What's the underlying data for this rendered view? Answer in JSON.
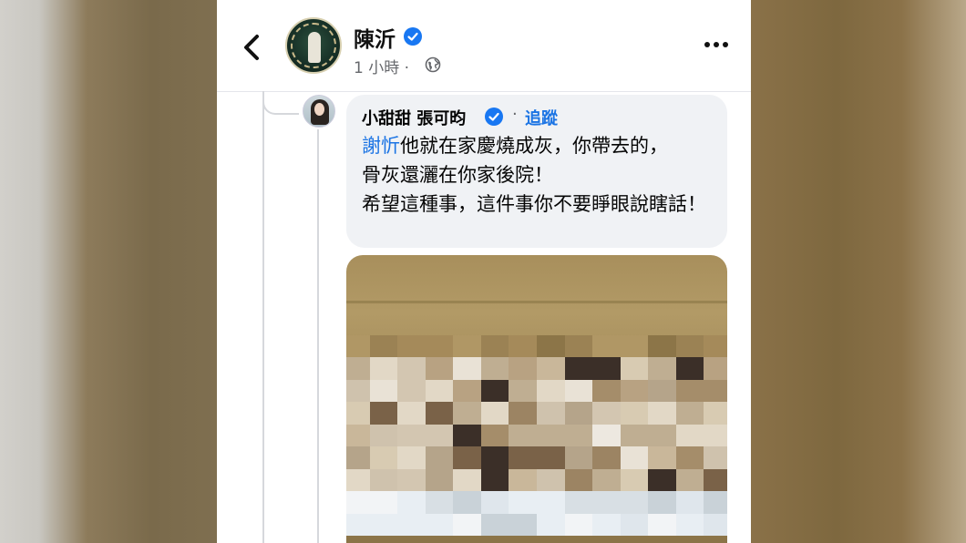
{
  "header": {
    "page_name": "陳沂",
    "timestamp": "1 小時",
    "separator": "·"
  },
  "comment": {
    "author": "小甜甜 張可昀",
    "separator": "·",
    "follow_label": "追蹤",
    "mention": "謝忻",
    "text_line1": "他就在家慶燒成灰，你帶去的，",
    "text_line2": "骨灰還灑在你家後院！",
    "text_line3": "希望這種事，這件事你不要睜眼說瞎話！"
  },
  "icons": {
    "back": "chevron-left-icon",
    "verified": "verified-badge-icon",
    "globe": "globe-icon",
    "more": "more-options-icon"
  },
  "colors": {
    "accent": "#1b74e4",
    "verified": "#1877f2",
    "bubble": "#f0f2f5"
  }
}
